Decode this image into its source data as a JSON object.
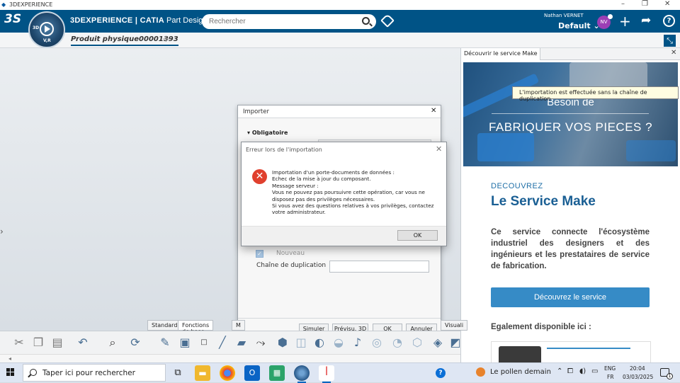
{
  "window": {
    "title": "3DEXPERIENCE"
  },
  "header": {
    "brand_bold": "3DEXPERIENCE",
    "brand_app": " | CATIA",
    "brand_role": " Part Design",
    "compass_label_3d": "3D",
    "compass_label_vr": "V,R",
    "search_placeholder": "Rechercher",
    "user_name": "Nathan VERNET",
    "workspace": "Default",
    "avatar_initials": "NV"
  },
  "tabs": {
    "document": "Produit physique00001393",
    "add": "+"
  },
  "right_panel": {
    "tab_label": "Découvrir le service Make",
    "tooltip": "L'importation est effectuée sans la chaîne de duplication",
    "banner_line1": "Besoin de",
    "banner_line2": "FABRIQUER VOS PIECES ?",
    "kicker": "DECOUVREZ",
    "title": "Le Service Make",
    "description": "Ce service connecte l'écosystème industriel des designers et des ingénieurs et les prestataires de service de fabrication.",
    "cta": "Découvrez le service",
    "also": "Egalement disponible ici :"
  },
  "importer": {
    "title": "Importer",
    "section": "Obligatoire",
    "nouveau_label": "Nouveau",
    "duplication_label": "Chaîne de duplication",
    "buttons": {
      "simulate": "Simuler",
      "preview": "Prévisu. 3D",
      "ok": "OK",
      "cancel": "Annuler"
    }
  },
  "error_dialog": {
    "title": "Erreur lors de l'importation",
    "message": "Importation d'un porte-documents de données :\nEchec de la mise à jour du composant.\nMessage serveur :\nVous ne pouvez pas poursuivre cette opération, car vous ne disposez pas des privilèges nécessaires.\nSi vous avez des questions relatives à vos privilèges, contactez votre administrateur.",
    "ok": "OK"
  },
  "toolbar": {
    "tabs": [
      "Standard",
      "Fonctions de base",
      "M"
    ],
    "right_tab": "Visuali",
    "icons": [
      "cut-icon",
      "copy-icon",
      "paste-icon",
      "undo-icon",
      "zoom-icon",
      "rotate-icon",
      "sketch-icon",
      "box-icon",
      "point-icon",
      "line-icon",
      "plane-icon",
      "axis-icon",
      "pad-icon",
      "pocket-icon",
      "shaft-icon",
      "groove-icon",
      "rib-icon",
      "hole-icon",
      "fillet-icon",
      "chamfer-icon",
      "shell-icon",
      "draft-icon"
    ]
  },
  "taskbar": {
    "search_text": "Taper ici pour rechercher",
    "weather": "Le pollen demain",
    "lang_top": "ENG",
    "lang_bottom": "FR",
    "time": "20:04",
    "date": "03/03/2025",
    "notif_count": "1"
  },
  "colors": {
    "header": "#005386",
    "accent": "#368bc6",
    "error": "#e0402e"
  }
}
